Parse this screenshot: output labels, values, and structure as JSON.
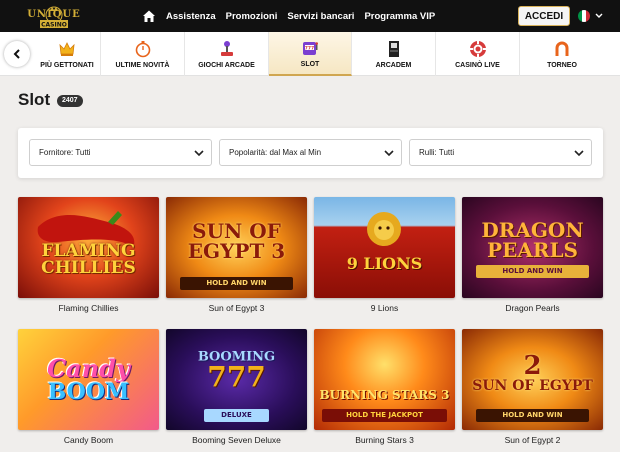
{
  "brand": {
    "logo_word": "UNIQUE",
    "logo_sub": "CASINO"
  },
  "nav": {
    "items": [
      "Assistenza",
      "Promozioni",
      "Servizi bancari",
      "Programma VIP"
    ],
    "login_label": "ACCEDI",
    "language_flag": "italy-flag"
  },
  "categories": [
    {
      "label": "PIÙ GETTONATI",
      "icon": "crown-icon",
      "active": false
    },
    {
      "label": "ULTIME NOVITÀ",
      "icon": "stopwatch-icon",
      "active": false
    },
    {
      "label": "GIOCHI ARCADE",
      "icon": "joystick-icon",
      "active": false
    },
    {
      "label": "SLOT",
      "icon": "slot-machine-icon",
      "active": true
    },
    {
      "label": "ARCADEM",
      "icon": "arcade-cabinet-icon",
      "active": false
    },
    {
      "label": "CASINÒ LIVE",
      "icon": "roulette-chip-icon",
      "active": false
    },
    {
      "label": "TORNEO",
      "icon": "horseshoe-icon",
      "active": false
    }
  ],
  "page": {
    "title": "Slot",
    "count": "2407"
  },
  "filters": [
    {
      "value": "Fornitore: Tutti"
    },
    {
      "value": "Popolarità: dal Max al Min"
    },
    {
      "value": "Rulli: Tutti"
    }
  ],
  "games": [
    {
      "name": "Flaming Chillies",
      "art": [
        "FLAMING",
        "CHILLIES"
      ]
    },
    {
      "name": "Sun of Egypt 3",
      "art": [
        "SUN OF",
        "EGYPT 3"
      ],
      "plate": "HOLD AND WIN"
    },
    {
      "name": "9 Lions",
      "art": [
        "9 LIONS"
      ]
    },
    {
      "name": "Dragon Pearls",
      "art": [
        "DRAGON",
        "PEARLS"
      ],
      "plate": "HOLD AND WIN"
    },
    {
      "name": "Candy Boom",
      "art": [
        "Candy",
        "BOOM"
      ]
    },
    {
      "name": "Booming Seven Deluxe",
      "art": [
        "BOOMING",
        "777"
      ],
      "plate": "DELUXE"
    },
    {
      "name": "Burning Stars 3",
      "art": [
        "BURNING STARS 3"
      ],
      "plate": "HOLD THE JACKPOT"
    },
    {
      "name": "Sun of Egypt 2",
      "art": [
        "2",
        "SUN OF EGYPT"
      ],
      "plate": "HOLD AND WIN"
    }
  ],
  "colors": {
    "accent_gold": "#d0a650",
    "topbar_bg": "#111111",
    "page_bg": "#f0eeec"
  }
}
